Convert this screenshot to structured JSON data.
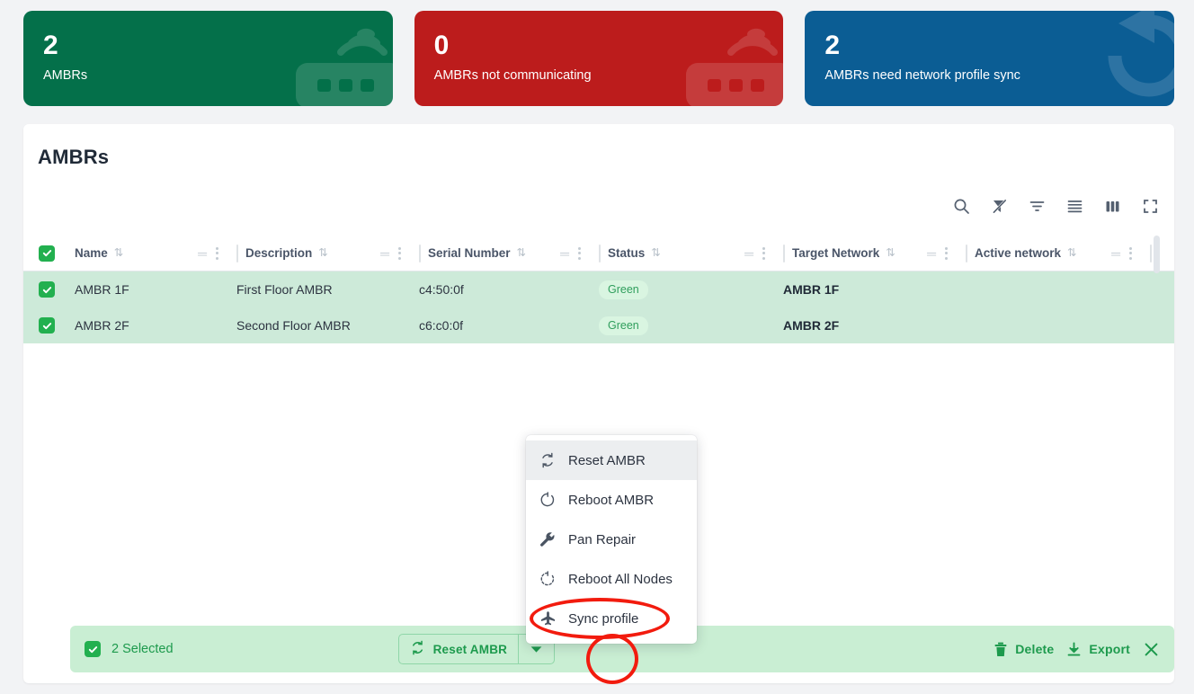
{
  "cards": [
    {
      "value": "2",
      "label": "AMBRs",
      "color": "#04704a",
      "icon": "router-signal-icon"
    },
    {
      "value": "0",
      "label": "AMBRs not communicating",
      "color": "#bc1c1c",
      "icon": "router-signal-icon"
    },
    {
      "value": "2",
      "label": "AMBRs need network profile sync",
      "color": "#0b5d94",
      "icon": "sync-arrow-icon"
    }
  ],
  "panel": {
    "title": "AMBRs",
    "toolbar": [
      {
        "name": "search-icon",
        "label": "Search"
      },
      {
        "name": "clear-filter-icon",
        "label": "Clear filters"
      },
      {
        "name": "filter-icon",
        "label": "Filter"
      },
      {
        "name": "density-icon",
        "label": "Density"
      },
      {
        "name": "columns-icon",
        "label": "Columns"
      },
      {
        "name": "fullscreen-icon",
        "label": "Fullscreen"
      }
    ]
  },
  "table": {
    "columns": [
      {
        "key": "name",
        "label": "Name"
      },
      {
        "key": "description",
        "label": "Description"
      },
      {
        "key": "serial",
        "label": "Serial Number"
      },
      {
        "key": "status",
        "label": "Status"
      },
      {
        "key": "target",
        "label": "Target Network"
      },
      {
        "key": "active",
        "label": "Active network"
      }
    ],
    "select_all_checked": true,
    "rows": [
      {
        "selected": true,
        "name": "AMBR 1F",
        "description": "First Floor AMBR",
        "serial": "c4:50:0f",
        "status": "Green",
        "target": "AMBR 1F",
        "active": ""
      },
      {
        "selected": true,
        "name": "AMBR 2F",
        "description": "Second Floor AMBR",
        "serial": "c6:c0:0f",
        "status": "Green",
        "target": "AMBR 2F",
        "active": ""
      }
    ]
  },
  "menu": {
    "items": [
      {
        "label": "Reset AMBR",
        "icon": "reset-cycle-icon",
        "highlighted": true
      },
      {
        "label": "Reboot AMBR",
        "icon": "reboot-circle-icon",
        "highlighted": false
      },
      {
        "label": "Pan Repair",
        "icon": "wrench-icon",
        "highlighted": false
      },
      {
        "label": "Reboot All Nodes",
        "icon": "reboot-dashed-icon",
        "highlighted": false
      },
      {
        "label": "Sync profile",
        "icon": "airplane-icon",
        "highlighted": false
      }
    ]
  },
  "selection_bar": {
    "count_label": "2 Selected",
    "primary_action": "Reset AMBR",
    "delete_label": "Delete",
    "export_label": "Export",
    "close_label": ""
  },
  "annotations": {
    "color": "#f21b0e",
    "targets": [
      "Sync profile",
      "Reset AMBR dropdown caret"
    ]
  }
}
